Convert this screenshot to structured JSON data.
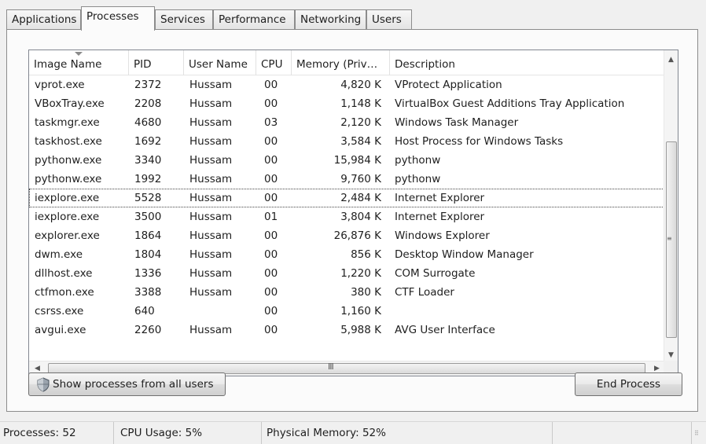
{
  "tabs": [
    {
      "label": "Applications"
    },
    {
      "label": "Processes"
    },
    {
      "label": "Services"
    },
    {
      "label": "Performance"
    },
    {
      "label": "Networking"
    },
    {
      "label": "Users"
    }
  ],
  "active_tab": "Processes",
  "table": {
    "columns": [
      "Image Name",
      "PID",
      "User Name",
      "CPU",
      "Memory (Priv…",
      "Description"
    ],
    "rows": [
      {
        "name": "vprot.exe",
        "pid": "2372",
        "user": "Hussam",
        "cpu": "00",
        "mem": "4,820 K",
        "desc": "VProtect Application"
      },
      {
        "name": "VBoxTray.exe",
        "pid": "2208",
        "user": "Hussam",
        "cpu": "00",
        "mem": "1,148 K",
        "desc": "VirtualBox Guest Additions Tray Application"
      },
      {
        "name": "taskmgr.exe",
        "pid": "4680",
        "user": "Hussam",
        "cpu": "03",
        "mem": "2,120 K",
        "desc": "Windows Task Manager"
      },
      {
        "name": "taskhost.exe",
        "pid": "1692",
        "user": "Hussam",
        "cpu": "00",
        "mem": "3,584 K",
        "desc": "Host Process for Windows Tasks"
      },
      {
        "name": "pythonw.exe",
        "pid": "3340",
        "user": "Hussam",
        "cpu": "00",
        "mem": "15,984 K",
        "desc": "pythonw"
      },
      {
        "name": "pythonw.exe",
        "pid": "1992",
        "user": "Hussam",
        "cpu": "00",
        "mem": "9,760 K",
        "desc": "pythonw"
      },
      {
        "name": "iexplore.exe",
        "pid": "5528",
        "user": "Hussam",
        "cpu": "00",
        "mem": "2,484 K",
        "desc": "Internet Explorer"
      },
      {
        "name": "iexplore.exe",
        "pid": "3500",
        "user": "Hussam",
        "cpu": "01",
        "mem": "3,804 K",
        "desc": "Internet Explorer"
      },
      {
        "name": "explorer.exe",
        "pid": "1864",
        "user": "Hussam",
        "cpu": "00",
        "mem": "26,876 K",
        "desc": "Windows Explorer"
      },
      {
        "name": "dwm.exe",
        "pid": "1804",
        "user": "Hussam",
        "cpu": "00",
        "mem": "856 K",
        "desc": "Desktop Window Manager"
      },
      {
        "name": "dllhost.exe",
        "pid": "1336",
        "user": "Hussam",
        "cpu": "00",
        "mem": "1,220 K",
        "desc": "COM Surrogate"
      },
      {
        "name": "ctfmon.exe",
        "pid": "3388",
        "user": "Hussam",
        "cpu": "00",
        "mem": "380 K",
        "desc": "CTF Loader"
      },
      {
        "name": "csrss.exe",
        "pid": "640",
        "user": "",
        "cpu": "00",
        "mem": "1,160 K",
        "desc": ""
      },
      {
        "name": "avgui.exe",
        "pid": "2260",
        "user": "Hussam",
        "cpu": "00",
        "mem": "5,988 K",
        "desc": "AVG User Interface"
      }
    ],
    "selected_row": 6
  },
  "buttons": {
    "show_all": "Show processes from all users",
    "end_process": "End Process"
  },
  "scrollbar": {
    "h_grip": "III"
  },
  "status": {
    "processes": "Processes: 52",
    "cpu": "CPU Usage: 5%",
    "memory": "Physical Memory: 52%"
  },
  "icons": {
    "sort": "sort-arrow-icon",
    "shield": "uac-shield-icon",
    "up": "scroll-up-icon",
    "down": "scroll-down-icon",
    "left": "scroll-left-icon",
    "right": "scroll-right-icon"
  }
}
